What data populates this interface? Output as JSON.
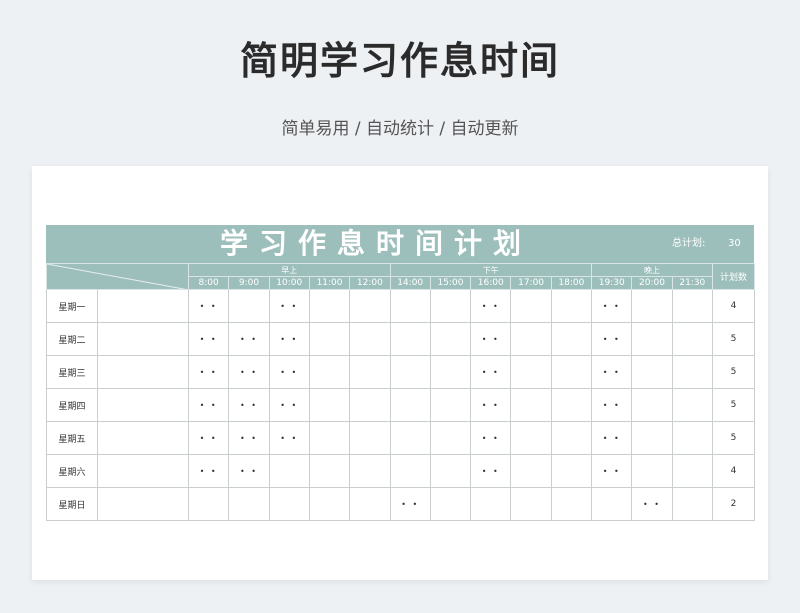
{
  "page": {
    "title": "简明学习作息时间",
    "subtitle": "简单易用 / 自动统计 / 自动更新"
  },
  "sheet": {
    "title": "学习作息时间计划",
    "total_label": "总计划:",
    "total_value": "30",
    "count_header": "计划数",
    "mark": "• •",
    "groups": [
      {
        "label": "早上",
        "times": [
          "8:00",
          "9:00",
          "10:00",
          "11:00",
          "12:00"
        ]
      },
      {
        "label": "下午",
        "times": [
          "14:00",
          "15:00",
          "16:00",
          "17:00",
          "18:00"
        ]
      },
      {
        "label": "晚上",
        "times": [
          "19:30",
          "20:00",
          "21:30"
        ]
      }
    ],
    "rows": [
      {
        "day": "星期一",
        "marks": [
          1,
          0,
          1,
          0,
          0,
          0,
          0,
          1,
          0,
          0,
          1,
          0,
          0
        ],
        "count": "4"
      },
      {
        "day": "星期二",
        "marks": [
          1,
          1,
          1,
          0,
          0,
          0,
          0,
          1,
          0,
          0,
          1,
          0,
          0
        ],
        "count": "5"
      },
      {
        "day": "星期三",
        "marks": [
          1,
          1,
          1,
          0,
          0,
          0,
          0,
          1,
          0,
          0,
          1,
          0,
          0
        ],
        "count": "5"
      },
      {
        "day": "星期四",
        "marks": [
          1,
          1,
          1,
          0,
          0,
          0,
          0,
          1,
          0,
          0,
          1,
          0,
          0
        ],
        "count": "5"
      },
      {
        "day": "星期五",
        "marks": [
          1,
          1,
          1,
          0,
          0,
          0,
          0,
          1,
          0,
          0,
          1,
          0,
          0
        ],
        "count": "5"
      },
      {
        "day": "星期六",
        "marks": [
          1,
          1,
          0,
          0,
          0,
          0,
          0,
          1,
          0,
          0,
          1,
          0,
          0
        ],
        "count": "4"
      },
      {
        "day": "星期日",
        "marks": [
          0,
          0,
          0,
          0,
          0,
          1,
          0,
          0,
          0,
          0,
          0,
          1,
          0
        ],
        "count": "2"
      }
    ]
  },
  "colors": {
    "header_band": "#9dbfbc",
    "page_background": "#eef1f4"
  }
}
